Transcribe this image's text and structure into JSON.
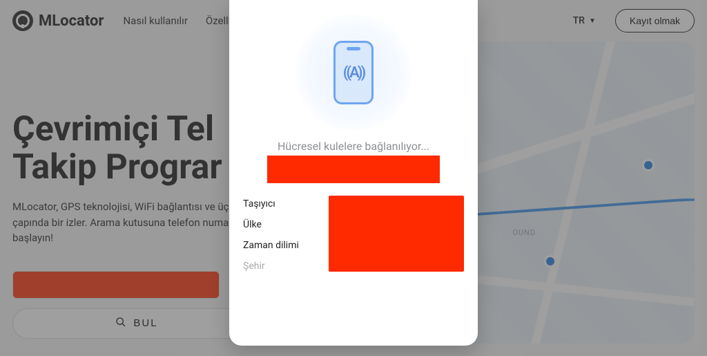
{
  "header": {
    "brand": "MLocator",
    "nav": {
      "how": "Nasıl kullanılır",
      "features": "Özellik"
    },
    "lang": "TR",
    "signup": "Kayıt olmak"
  },
  "hero": {
    "title_line1": "Çevrimiçi Tel",
    "title_line2": "Takip Prograr",
    "desc": "MLocator, GPS teknolojisi, WiFi bağlantısı ve üçgenlemesini kullanarak dünya çapında bir izler. Arama kutusuna telefon numarasını gir konum aramaya başlayın!",
    "find_label": "BUL"
  },
  "map": {
    "label1": "OUND"
  },
  "modal": {
    "status": "Hücresel kulelere bağlanılıyor...",
    "labels": {
      "carrier": "Taşıyıcı",
      "country": "Ülke",
      "tz": "Zaman dilimi",
      "city": "Şehir"
    }
  }
}
